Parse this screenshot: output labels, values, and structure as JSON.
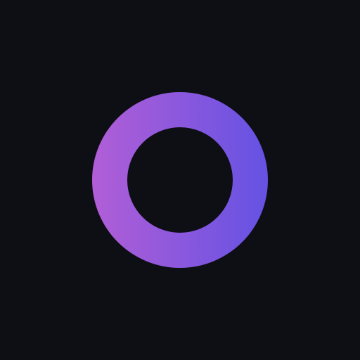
{
  "screen": {
    "background_color": "#0e0e15"
  },
  "logo": {
    "icon": "ring-icon",
    "gradient_start_color": "#b25ed7",
    "gradient_end_color": "#6452e3",
    "hole_color": "#0e0e15"
  }
}
